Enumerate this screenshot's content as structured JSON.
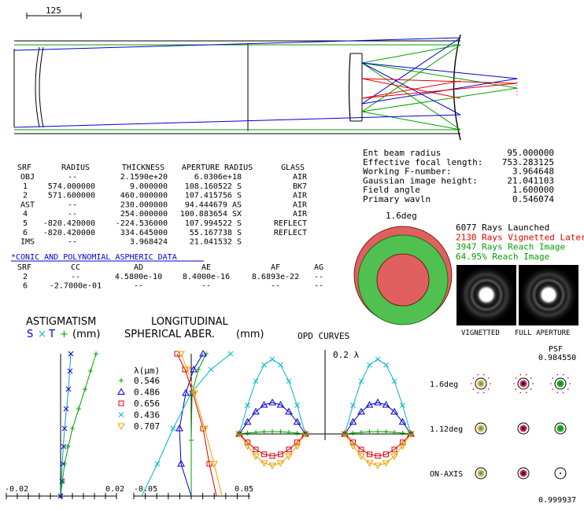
{
  "scale_bar": {
    "label": "125"
  },
  "system_info": [
    {
      "label": "Ent beam radius",
      "value": "95.000000"
    },
    {
      "label": "Effective focal length:",
      "value": "753.283125"
    },
    {
      "label": "Working F-number:",
      "value": "3.964648"
    },
    {
      "label": "Gaussian image height:",
      "value": "21.041103"
    },
    {
      "label": "Field angle",
      "value": "1.600000"
    },
    {
      "label": "Primary wavln",
      "value": "0.546074"
    }
  ],
  "surface_table": {
    "headers": [
      "SRF",
      "RADIUS",
      "THICKNESS",
      "APERTURE RADIUS",
      "GLASS"
    ],
    "rows": [
      [
        "OBJ",
        "--",
        "2.1590e+20",
        "6.0306e+18",
        "AIR"
      ],
      [
        "1",
        "574.000000",
        "9.000000",
        "108.160522 S",
        "BK7"
      ],
      [
        "2",
        "571.600000",
        "460.000000",
        "107.415756 S",
        "AIR"
      ],
      [
        "AST",
        "--",
        "230.000000",
        "94.444679 AS",
        "AIR"
      ],
      [
        "4",
        "--",
        "254.000000",
        "100.883654 SX",
        "AIR"
      ],
      [
        "5",
        "-820.420000",
        "-224.536000",
        "107.994522 S",
        "REFLECT"
      ],
      [
        "6",
        "-820.420000",
        "334.645000",
        "55.167738 S",
        "REFLECT"
      ],
      [
        "IMS",
        "--",
        "3.968424",
        "21.041532 S",
        ""
      ]
    ]
  },
  "conic_table": {
    "title": "*CONIC AND POLYNOMIAL ASPHERIC DATA",
    "headers": [
      "SRF",
      "CC",
      "AD",
      "AE",
      "AF",
      "AG"
    ],
    "rows": [
      [
        "2",
        "--",
        "4.5800e-10",
        "8.4000e-16",
        "8.6893e-22",
        "--"
      ],
      [
        "6",
        "-2.7000e-01",
        "--",
        "--",
        "--",
        "--"
      ]
    ]
  },
  "footprint": {
    "field_label": "1.6deg",
    "stats": [
      {
        "text": "6077 Rays Launched",
        "color": "#000000"
      },
      {
        "text": "2130 Rays Vignetted Later",
        "color": "#e00000"
      },
      {
        "text": "3947 Rays Reach Image",
        "color": "#00a000"
      },
      {
        "text": "64.95% Reach Image",
        "color": "#00a000"
      }
    ],
    "psf_labels": [
      "VIGNETTED",
      "FULL APERTURE"
    ]
  },
  "astigmatism": {
    "title": "ASTIGMATISM",
    "legend_s": "S",
    "legend_x": "×",
    "legend_t": "T",
    "legend_plus": "+",
    "unit": "(mm)",
    "xmin_label": "-0.02",
    "xmax_label": "0.02"
  },
  "longitudinal": {
    "title_1": "LONGITUDINAL",
    "title_2": "SPHERICAL ABER.",
    "unit": "(mm)",
    "legend_title": "λ(μm)",
    "wavelengths": [
      {
        "value": "0.546",
        "color": "#00a000",
        "marker": "plus"
      },
      {
        "value": "0.486",
        "color": "#0000d0",
        "marker": "triangle"
      },
      {
        "value": "0.656",
        "color": "#e00000",
        "marker": "square"
      },
      {
        "value": "0.436",
        "color": "#00b8c8",
        "marker": "x"
      },
      {
        "value": "0.707",
        "color": "#f0a000",
        "marker": "tri-down"
      }
    ],
    "xmin_label": "-0.05",
    "xmax_label": "0.05"
  },
  "opd": {
    "title": "OPD CURVES",
    "scale_label": "0.2 λ"
  },
  "spots": {
    "psf_header": "PSF",
    "psf_top_value": "0.984550",
    "psf_bottom_value": "0.999937",
    "fields": [
      "1.6deg",
      "1.12deg",
      "ON-AXIS"
    ]
  }
}
